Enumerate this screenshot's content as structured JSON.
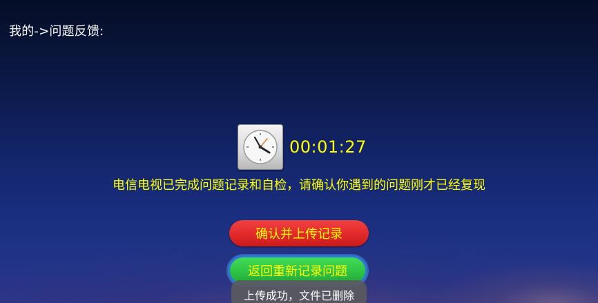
{
  "header": {
    "breadcrumb": "我的->问题反馈:"
  },
  "timer": {
    "icon": "clock-icon",
    "elapsed": "00:01:27"
  },
  "message": "电信电视已完成问题记录和自检，请确认你遇到的问题刚才已经复现",
  "actions": {
    "confirm_upload_label": "确认并上传记录",
    "rerecord_label": "返回重新记录问题"
  },
  "toast": "上传成功，文件已删除",
  "colors": {
    "accent_text": "#ffff00",
    "confirm_button": "#e22a2a",
    "rerecord_button": "#2ec345",
    "focus_ring": "#2a7bd8"
  }
}
